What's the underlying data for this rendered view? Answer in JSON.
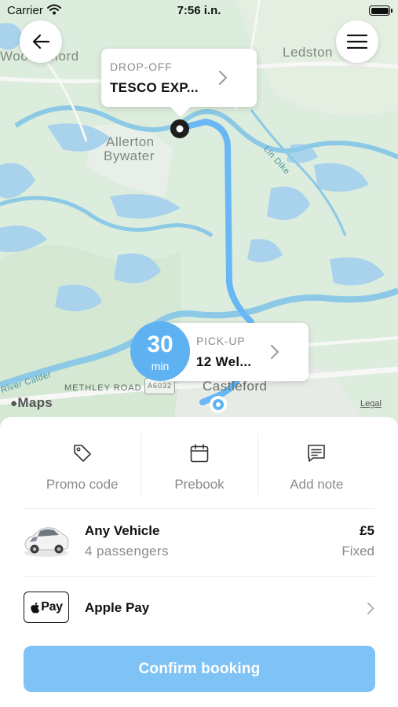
{
  "status_bar": {
    "carrier": "Carrier",
    "time": "7:56 i.n."
  },
  "map": {
    "labels": {
      "woodlesford": "Woodlesford",
      "ledston": "Ledston",
      "allerton": "Allerton",
      "bywater": "Bywater",
      "lin_dike": "Lin Dike",
      "methley_road": "METHLEY ROAD",
      "road_number": "A6032",
      "castleford": "Castleford",
      "river_calder": "River Calder"
    },
    "attribution": "Maps",
    "legal": "Legal",
    "route_color": "#69b8f5"
  },
  "dropoff": {
    "label": "DROP-OFF",
    "value": "TESCO EXP..."
  },
  "pickup": {
    "label": "PICK-UP",
    "value": "12 Wel...",
    "eta_value": "30",
    "eta_unit": "min"
  },
  "actions": [
    {
      "label": "Promo code",
      "icon": "tag-icon"
    },
    {
      "label": "Prebook",
      "icon": "calendar-icon"
    },
    {
      "label": "Add note",
      "icon": "note-icon"
    }
  ],
  "vehicle": {
    "name": "Any Vehicle",
    "passengers": "4 passengers",
    "price": "£5",
    "price_type": "Fixed"
  },
  "payment": {
    "badge": "Pay",
    "label": "Apple Pay"
  },
  "confirm": {
    "label": "Confirm booking",
    "color": "#7fc2f5"
  }
}
